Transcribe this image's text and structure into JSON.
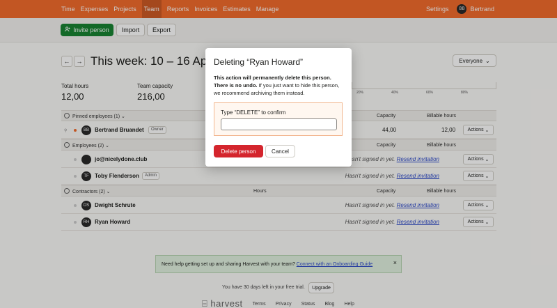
{
  "nav": {
    "items": [
      "Time",
      "Expenses",
      "Projects",
      "Team",
      "Reports",
      "Invoices",
      "Estimates",
      "Manage"
    ],
    "active": "Team",
    "settings": "Settings",
    "user_initials": "BB",
    "user_name": "Bertrand"
  },
  "toolbar": {
    "invite": "Invite person",
    "import": "Import",
    "export": "Export"
  },
  "page": {
    "prev_icon": "←",
    "next_icon": "→",
    "title": "This week: 10 – 16 Apr",
    "filter": "Everyone"
  },
  "stats": {
    "total_hours_label": "Total hours",
    "total_hours": "12,00",
    "team_capacity_label": "Team capacity",
    "team_capacity": "216,00"
  },
  "ruler_ticks": [
    "20%",
    "40%",
    "60%",
    "80%"
  ],
  "columns": {
    "hours": "Hours",
    "capacity": "Capacity",
    "billable": "Billable hours"
  },
  "sections": {
    "pinned": "Pinned employees (1)",
    "employees": "Employees (2)",
    "contractors": "Contractors (2)"
  },
  "rows": {
    "bertrand": {
      "initials": "BB",
      "name": "Bertrand Bruandet",
      "badge": "Owner",
      "capacity": "44,00",
      "billable": "12,00",
      "actions": "Actions"
    },
    "jo": {
      "initials": "",
      "name": "jo@nicelydone.club",
      "status": "Hasn't signed in yet.",
      "link": "Resend invitation",
      "actions": "Actions"
    },
    "toby": {
      "initials": "TF",
      "name": "Toby Flenderson",
      "badge": "Admin",
      "status": "Hasn't signed in yet.",
      "link": "Resend invitation",
      "actions": "Actions"
    },
    "dwight": {
      "initials": "DS",
      "name": "Dwight Schrute",
      "status": "Hasn't signed in yet.",
      "link": "Resend invitation",
      "actions": "Actions"
    },
    "ryan": {
      "initials": "RH",
      "name": "Ryan Howard",
      "status": "Hasn't signed in yet.",
      "link": "Resend invitation",
      "actions": "Actions"
    }
  },
  "help": {
    "text": "Need help getting set up and sharing Harvest with your team?",
    "link": "Connect with an Onboarding Guide",
    "close": "×"
  },
  "trial": {
    "text": "You have 30 days left in your free trial.",
    "upgrade": "Upgrade"
  },
  "footer": {
    "logo": "harvest",
    "links": [
      "Terms",
      "Privacy",
      "Status",
      "Blog",
      "Help"
    ]
  },
  "modal": {
    "title": "Deleting “Ryan Howard”",
    "warning_bold": "This action will permanently delete this person. There is no undo.",
    "warning_rest": " If you just want to hide this person, we recommend archiving them instead.",
    "confirm_label": "Type “DELETE” to confirm",
    "input_value": "",
    "delete_button": "Delete person",
    "cancel_button": "Cancel"
  },
  "colors": {
    "brand": "#f36c2c",
    "primary": "#188433",
    "danger": "#d4252d",
    "link": "#2d4ac9"
  }
}
